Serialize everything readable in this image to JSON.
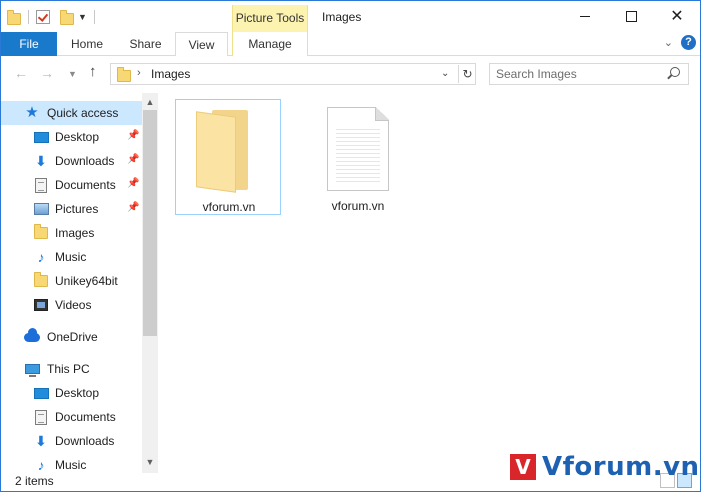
{
  "window": {
    "title": "Images",
    "contextual_tab_group": "Picture Tools"
  },
  "ribbon": {
    "tabs": [
      {
        "label": "File"
      },
      {
        "label": "Home"
      },
      {
        "label": "Share"
      },
      {
        "label": "View"
      },
      {
        "label": "Manage"
      }
    ],
    "help": "?"
  },
  "address_bar": {
    "breadcrumb": "Images",
    "search_placeholder": "Search Images"
  },
  "sidebar": {
    "quick_access": {
      "label": "Quick access",
      "items": [
        {
          "label": "Desktop",
          "icon": "desktop-icon",
          "pinned": true
        },
        {
          "label": "Downloads",
          "icon": "downloads-icon",
          "pinned": true
        },
        {
          "label": "Documents",
          "icon": "documents-icon",
          "pinned": true
        },
        {
          "label": "Pictures",
          "icon": "pictures-icon",
          "pinned": true
        },
        {
          "label": "Images",
          "icon": "folder-icon",
          "pinned": false
        },
        {
          "label": "Music",
          "icon": "music-icon",
          "pinned": false
        },
        {
          "label": "Unikey64bit",
          "icon": "folder-icon",
          "pinned": false
        },
        {
          "label": "Videos",
          "icon": "videos-icon",
          "pinned": false
        }
      ]
    },
    "onedrive": {
      "label": "OneDrive"
    },
    "this_pc": {
      "label": "This PC",
      "items": [
        {
          "label": "Desktop",
          "icon": "desktop-icon"
        },
        {
          "label": "Documents",
          "icon": "documents-icon"
        },
        {
          "label": "Downloads",
          "icon": "downloads-icon"
        },
        {
          "label": "Music",
          "icon": "music-icon"
        }
      ]
    }
  },
  "files": [
    {
      "name": "vforum.vn",
      "type": "folder",
      "selected": true
    },
    {
      "name": "vforum.vn",
      "type": "file",
      "selected": false
    }
  ],
  "status": {
    "item_count": "2 items"
  },
  "watermark": {
    "logo_letter": "V",
    "text": "Vforum.vn"
  },
  "colors": {
    "accent": "#1979ca",
    "selection": "#cce8ff",
    "context_tab": "#fdf3b1",
    "watermark_blue": "#1e61b3",
    "watermark_red": "#d8262b"
  }
}
